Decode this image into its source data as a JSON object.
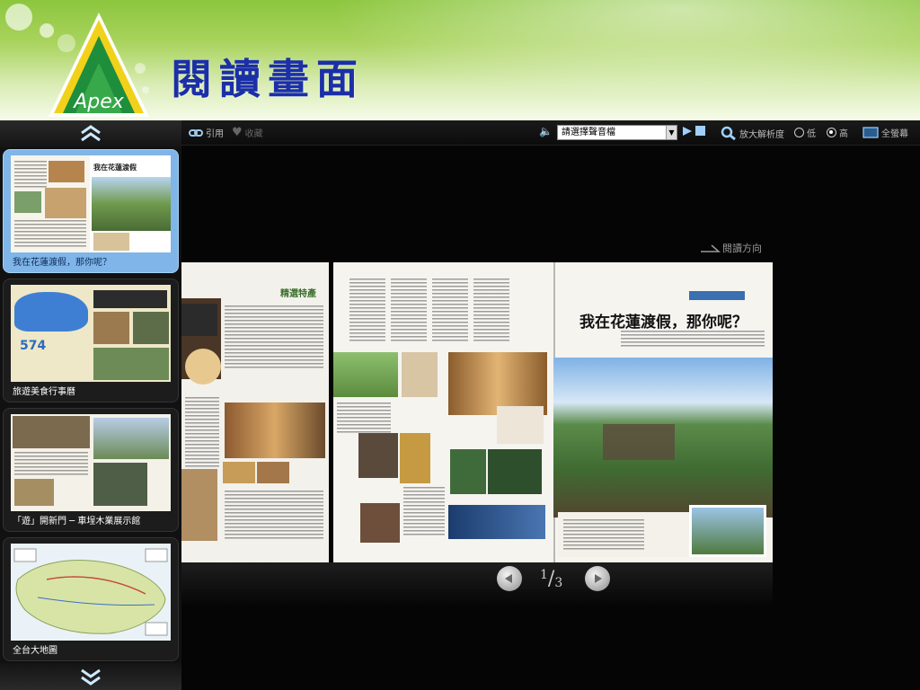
{
  "header": {
    "title": "閱讀畫面",
    "logo_text": "Apex"
  },
  "toolbar": {
    "quote_label": "引用",
    "favorite_label": "收藏",
    "audio_select_value": "請選擇聲音檔",
    "zoom_label": "放大解析度",
    "res_low_label": "低",
    "res_high_label": "高",
    "selected_resolution": "高",
    "fullscreen_label": "全螢幕"
  },
  "reading_direction_label": "閱讀方向",
  "sidebar": {
    "items": [
      {
        "label": "我在花蓮渡假，那你呢？",
        "active": true
      },
      {
        "label": "旅遊美食行事曆",
        "active": false
      },
      {
        "label": "「遊」開新門 ─ 車埕木業展示館",
        "active": false
      },
      {
        "label": "全台大地圖",
        "active": false
      }
    ]
  },
  "magazine": {
    "right_headline": "我在花蓮渡假，那你呢？",
    "left_section_title": "精選特產"
  },
  "pager": {
    "current": "1",
    "total": "3"
  },
  "icons": {
    "scroll_up": "chevron-up-icon",
    "scroll_down": "chevron-down-icon",
    "quote": "link-icon",
    "favorite": "heart-icon",
    "audio": "speaker-icon",
    "play": "play-icon",
    "stop": "stop-icon",
    "zoom": "magnifier-icon",
    "fullscreen": "screen-icon",
    "prev": "prev-arrow-icon",
    "next": "next-arrow-icon"
  },
  "colors": {
    "title": "#1b2fa8",
    "active_thumb": "#7fb5e8",
    "banner_green": "#8cc63e"
  }
}
